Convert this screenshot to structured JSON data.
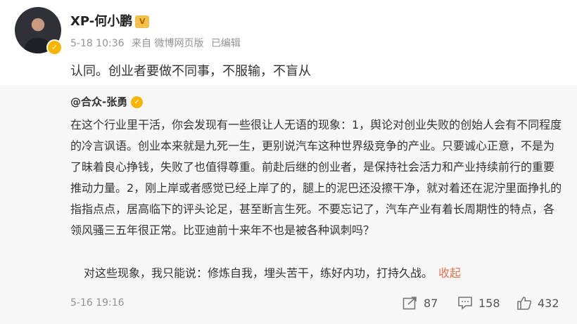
{
  "post": {
    "author": "XP-何小鹏",
    "badge": "V",
    "meta": {
      "date": "5-18 10:36",
      "source": "来自 微博网页版",
      "edited": "已编辑"
    },
    "text": "认同。创业者要做不同事，不服输，不盲从"
  },
  "retweet": {
    "author": "@合众-张勇",
    "text": "在这个行业里干活，你会发现有一些很让人无语的现象：1，舆论对创业失败的创始人会有不同程度的冷言讽语。创业本来就是九死一生，更别说汽车这种世界级竞争的产业。只要诚心正意，不是为了昧着良心挣钱，失败了也值得尊重。前赴后继的创业者，是保持社会活力和产业持续前行的重要推动力量。2，刚上岸或者感觉已经上岸了的，腿上的泥巴还没擦干净，就对着还在泥泞里面挣扎的指指点点，居高临下的评头论足，甚至断言生死。不要忘记了，汽车产业有着长周期性的特点，各领风骚三五年很正常。比亚迪前十来年不也是被各种讽刺吗？",
    "last_line": "对这些现象，我只能说：修炼自我，埋头苦干，练好内功，打持久战。",
    "collapse": "收起",
    "date": "5-16 19:16",
    "shares": "87",
    "comments": "158",
    "likes": "432"
  }
}
